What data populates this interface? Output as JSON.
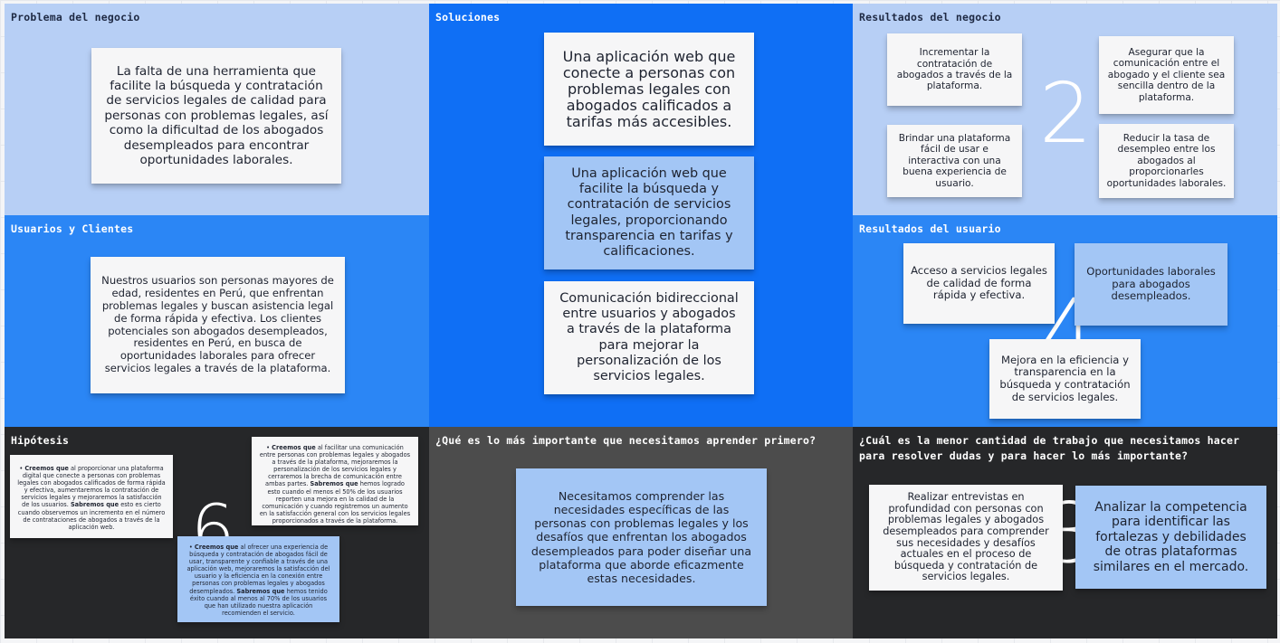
{
  "colors": {
    "light_panel": "#b7cff5",
    "blue_panel": "#2b86f5",
    "solutions_panel": "#0f6ff5",
    "dark_panel": "#262729",
    "gray_panel": "#4c4c4c",
    "sticky_white": "#f6f6f7",
    "sticky_blue": "#a3c6f5"
  },
  "panels": {
    "problema": {
      "title": "Problema del negocio",
      "note": "La falta de una herramienta que facilite la búsqueda y contratación de servicios legales de calidad para personas con problemas legales, así como la dificultad de los abogados desempleados para encontrar oportunidades laborales."
    },
    "usuarios": {
      "title": "Usuarios y Clientes",
      "note": "Nuestros usuarios son personas mayores de edad, residentes en Perú, que enfrentan problemas legales y buscan asistencia legal de forma rápida y efectiva. Los clientes potenciales son abogados desempleados, residentes en Perú, en busca de oportunidades laborales para ofrecer servicios legales a través de la plataforma."
    },
    "hipotesis": {
      "title": "Hipótesis",
      "number": "6",
      "notes": [
        {
          "bold1": "Creemos que",
          "text1": " al proporcionar una plataforma digital que conecte a personas con problemas legales con abogados calificados de forma rápida y efectiva, aumentaremos la contratación de servicios legales y mejoraremos la satisfacción de los usuarios. ",
          "bold2": "Sabremos que",
          "text2": " esto es cierto cuando observemos un incremento en el número de contrataciones de abogados a través de la aplicación web."
        },
        {
          "bold1": "Creemos que",
          "text1": " al facilitar una comunicación entre personas con problemas legales y abogados a través de la plataforma, mejoraremos la personalización de los servicios legales y cerraremos la brecha de comunicación entre ambas partes. ",
          "bold2": "Sabremos que",
          "text2": " hemos logrado esto cuando el menos el 50% de los usuarios reporten una mejora en la calidad de la comunicación y cuando registremos un aumento en la satisfacción general con los servicios legales proporcionados a través de la plataforma."
        },
        {
          "bold1": "Creemos que",
          "text1": " al ofrecer una experiencia de búsqueda y contratación de abogados fácil de usar, transparente y confiable a través de una aplicación web, mejoraremos la satisfacción del usuario y la eficiencia en la conexión entre personas con problemas legales y abogados desempleados. ",
          "bold2": "Sabremos que",
          "text2": " hemos tenido éxito cuando al menos al 70% de los usuarios que han utilizado nuestra aplicación recomienden el servicio."
        }
      ]
    },
    "soluciones": {
      "title": "Soluciones",
      "notes": [
        "Una aplicación web que conecte a personas con problemas legales con abogados calificados a tarifas más accesibles.",
        "Una aplicación web que facilite la búsqueda y contratación de servicios legales, proporcionando transparencia en tarifas y calificaciones.",
        "Comunicación bidireccional entre usuarios y abogados a través de la plataforma para mejorar la personalización de los servicios legales."
      ]
    },
    "aprender": {
      "title": "¿Qué es lo más importante que necesitamos aprender primero?",
      "note": "Necesitamos comprender las necesidades específicas de las personas con problemas legales y los desafíos que enfrentan los abogados desempleados para poder diseñar una plataforma que aborde eficazmente estas necesidades."
    },
    "resultados_negocio": {
      "title": "Resultados del negocio",
      "number": "2",
      "notes": [
        "Incrementar la contratación de abogados a través de la plataforma.",
        "Asegurar que la comunicación entre el abogado y el cliente sea sencilla dentro de la plataforma.",
        "Brindar una plataforma fácil de usar e interactiva con una buena experiencia de usuario.",
        "Reducir la tasa de desempleo entre los abogados al proporcionarles oportunidades laborales."
      ]
    },
    "resultados_usuario": {
      "title": "Resultados del usuario",
      "number": "4",
      "notes": [
        "Acceso a servicios legales de calidad de forma rápida y efectiva.",
        "Oportunidades laborales para abogados desempleados.",
        "Mejora en la eficiencia y transparencia en la búsqueda y contratación de servicios legales."
      ]
    },
    "menor_trabajo": {
      "title": "¿Cuál es la menor cantidad de trabajo que necesitamos hacer para resolver dudas y para hacer lo más importante?",
      "number": "3",
      "notes": [
        "Realizar entrevistas en profundidad con personas con problemas legales y abogados desempleados para comprender sus necesidades y desafíos actuales en el proceso de búsqueda y contratación de servicios legales.",
        "Analizar la competencia para identificar las fortalezas y debilidades de otras plataformas similares en el mercado."
      ]
    }
  }
}
